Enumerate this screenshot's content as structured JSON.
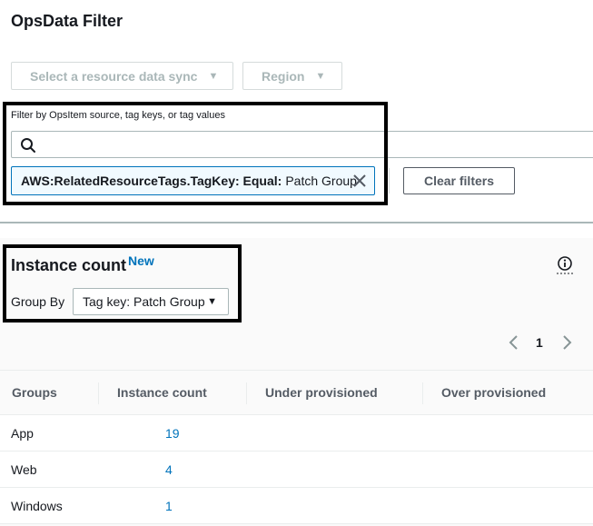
{
  "top_panel": {
    "title": "OpsData Filter",
    "sync_dropdown": {
      "label": "Select a resource data sync"
    },
    "region_dropdown": {
      "label": "Region"
    },
    "filter_label": "Filter by OpsItem source, tag keys, or tag values",
    "search": {
      "value": "",
      "placeholder": ""
    },
    "token": {
      "key": "AWS:RelatedResourceTags.TagKey: Equal:",
      "value": "Patch Group"
    },
    "clear_filters_label": "Clear filters"
  },
  "instance_count": {
    "title": "Instance count",
    "badge": "New",
    "group_by_label": "Group By",
    "group_by_value": "Tag key: Patch Group",
    "page": "1",
    "columns": [
      "Groups",
      "Instance count",
      "Under provisioned",
      "Over provisioned"
    ],
    "rows": [
      {
        "group": "App",
        "count": "19"
      },
      {
        "group": "Web",
        "count": "4"
      },
      {
        "group": "Windows",
        "count": "1"
      }
    ]
  },
  "colors": {
    "accent": "#0073bb",
    "highlight_border": "#000000",
    "token_background": "#f1faff",
    "disabled_text": "#aab7b8"
  },
  "icons": [
    "search-icon",
    "close-icon",
    "info-icon",
    "chevron-left-icon",
    "chevron-right-icon",
    "caret-down-icon"
  ]
}
